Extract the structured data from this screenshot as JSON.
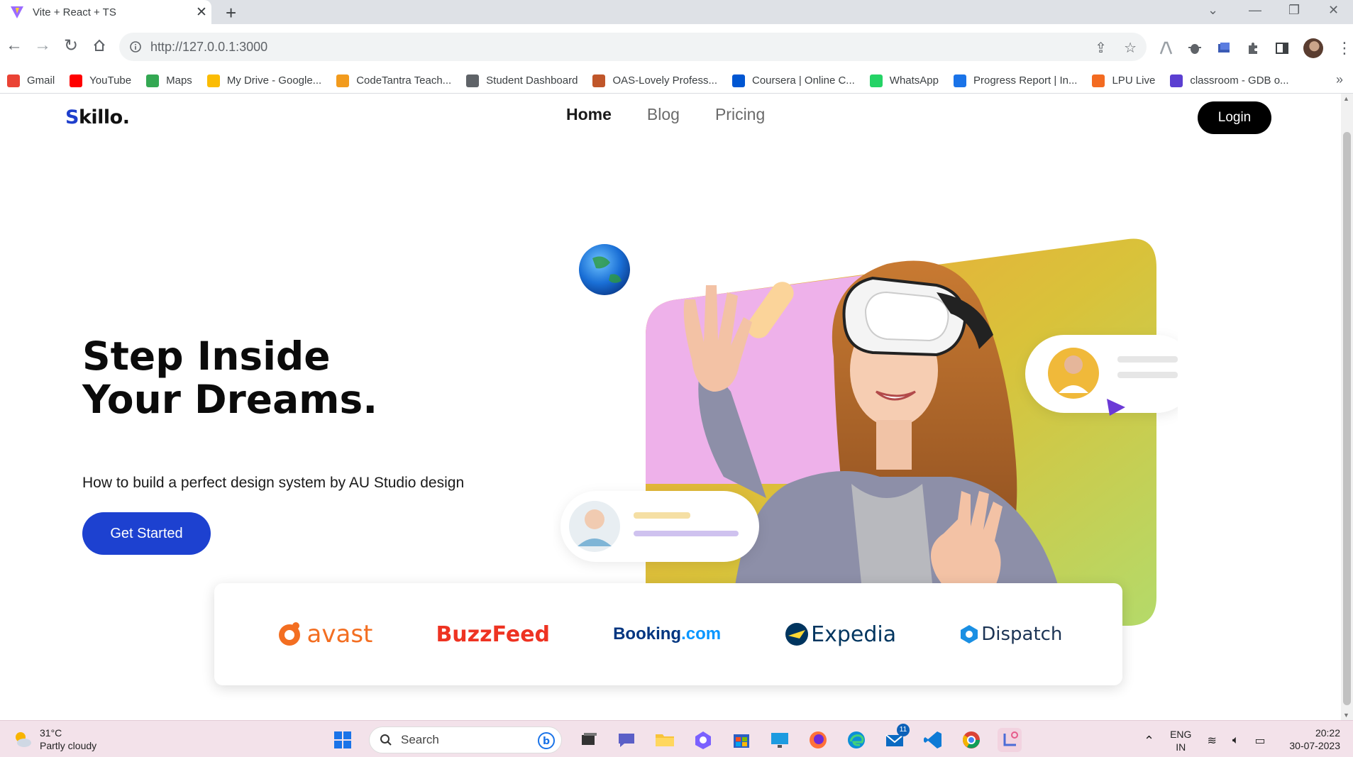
{
  "browser": {
    "tab_title": "Vite + React + TS",
    "url": "http://127.0.0.1:3000",
    "bookmarks": [
      {
        "label": "Gmail",
        "icon": "gmail-icon",
        "color": "#ea4335"
      },
      {
        "label": "YouTube",
        "icon": "youtube-icon",
        "color": "#ff0000"
      },
      {
        "label": "Maps",
        "icon": "maps-icon",
        "color": "#34a853"
      },
      {
        "label": "My Drive - Google...",
        "icon": "drive-icon",
        "color": "#fbbc04"
      },
      {
        "label": "CodeTantra Teach...",
        "icon": "codetantra-icon",
        "color": "#f29b1d"
      },
      {
        "label": "Student Dashboard",
        "icon": "globe-icon",
        "color": "#5f6368"
      },
      {
        "label": "OAS-Lovely Profess...",
        "icon": "lpu-icon",
        "color": "#c0562a"
      },
      {
        "label": "Coursera | Online C...",
        "icon": "coursera-icon",
        "color": "#0056d2"
      },
      {
        "label": "WhatsApp",
        "icon": "whatsapp-icon",
        "color": "#25d366"
      },
      {
        "label": "Progress Report | In...",
        "icon": "ist-icon",
        "color": "#1a73e8"
      },
      {
        "label": "LPU Live",
        "icon": "lpu-live-icon",
        "color": "#f36b21"
      },
      {
        "label": "classroom - GDB o...",
        "icon": "gdb-icon",
        "color": "#5b3fd1"
      }
    ]
  },
  "site": {
    "logo_s": "S",
    "logo_rest": "killo.",
    "nav": [
      {
        "label": "Home",
        "active": true
      },
      {
        "label": "Blog",
        "active": false
      },
      {
        "label": "Pricing",
        "active": false
      }
    ],
    "login_label": "Login",
    "hero_title": "Step Inside Your Dreams.",
    "hero_subtitle": "How to build a perfect design system by AU Studio design",
    "cta_label": "Get Started",
    "brands": [
      {
        "name": "avast",
        "color": "#f36e21"
      },
      {
        "name": "BuzzFeed",
        "color": "#e32"
      },
      {
        "name": "Booking.com",
        "color": "#003580",
        "accent": "#0896ff"
      },
      {
        "name": "Expedia",
        "color": "#00355f"
      },
      {
        "name": "Dispatch",
        "color": "#1c3455"
      }
    ]
  },
  "taskbar": {
    "temperature": "31°C",
    "weather": "Partly cloudy",
    "search_label": "Search",
    "mail_badge": "11",
    "lang_top": "ENG",
    "lang_bottom": "IN",
    "time": "20:22",
    "date": "30-07-2023"
  }
}
